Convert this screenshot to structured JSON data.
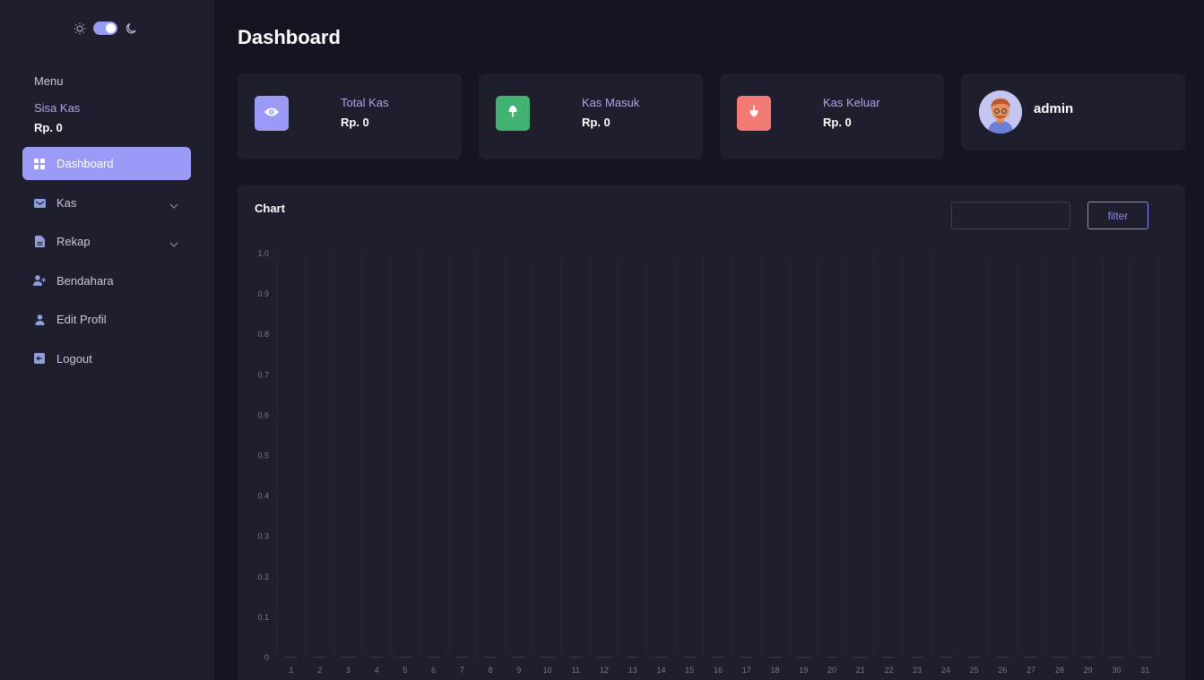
{
  "sidebar": {
    "menu_title": "Menu",
    "balance_label": "Sisa Kas",
    "balance_value": "Rp. 0",
    "items": [
      {
        "label": "Dashboard",
        "icon": "grid-icon",
        "active": true
      },
      {
        "label": "Kas",
        "icon": "wallet-icon",
        "expandable": true
      },
      {
        "label": "Rekap",
        "icon": "document-icon",
        "expandable": true
      },
      {
        "label": "Bendahara",
        "icon": "user-add-icon"
      },
      {
        "label": "Edit Profil",
        "icon": "user-icon"
      },
      {
        "label": "Logout",
        "icon": "logout-icon"
      }
    ]
  },
  "header": {
    "title": "Dashboard"
  },
  "cards": [
    {
      "label": "Total Kas",
      "value": "Rp. 0",
      "icon": "eye-icon",
      "color": "#9b9bf7"
    },
    {
      "label": "Kas Masuk",
      "value": "Rp. 0",
      "icon": "arrow-up-icon",
      "color": "#3fb36f"
    },
    {
      "label": "Kas Keluar",
      "value": "Rp. 0",
      "icon": "arrow-down-icon",
      "color": "#f47a76"
    }
  ],
  "profile": {
    "name": "admin"
  },
  "chart": {
    "title": "Chart",
    "filter_label": "filter",
    "filter_value": ""
  },
  "chart_data": {
    "type": "bar",
    "categories": [
      "1",
      "2",
      "3",
      "4",
      "5",
      "6",
      "7",
      "8",
      "9",
      "10",
      "11",
      "12",
      "13",
      "14",
      "15",
      "16",
      "17",
      "18",
      "19",
      "20",
      "21",
      "22",
      "23",
      "24",
      "25",
      "26",
      "27",
      "28",
      "29",
      "30",
      "31"
    ],
    "values": [
      0,
      0,
      0,
      0,
      0,
      0,
      0,
      0,
      0,
      0,
      0,
      0,
      0,
      0,
      0,
      0,
      0,
      0,
      0,
      0,
      0,
      0,
      0,
      0,
      0,
      0,
      0,
      0,
      0,
      0,
      0
    ],
    "ylim": [
      0,
      1.0
    ],
    "yticks": [
      "0",
      "0.1",
      "0.2",
      "0.3",
      "0.4",
      "0.5",
      "0.6",
      "0.7",
      "0.8",
      "0.9",
      "1.0"
    ],
    "grid": true
  },
  "colors": {
    "accent": "#9b9bf7",
    "background": "#151521",
    "panel": "#1e1e2d"
  }
}
